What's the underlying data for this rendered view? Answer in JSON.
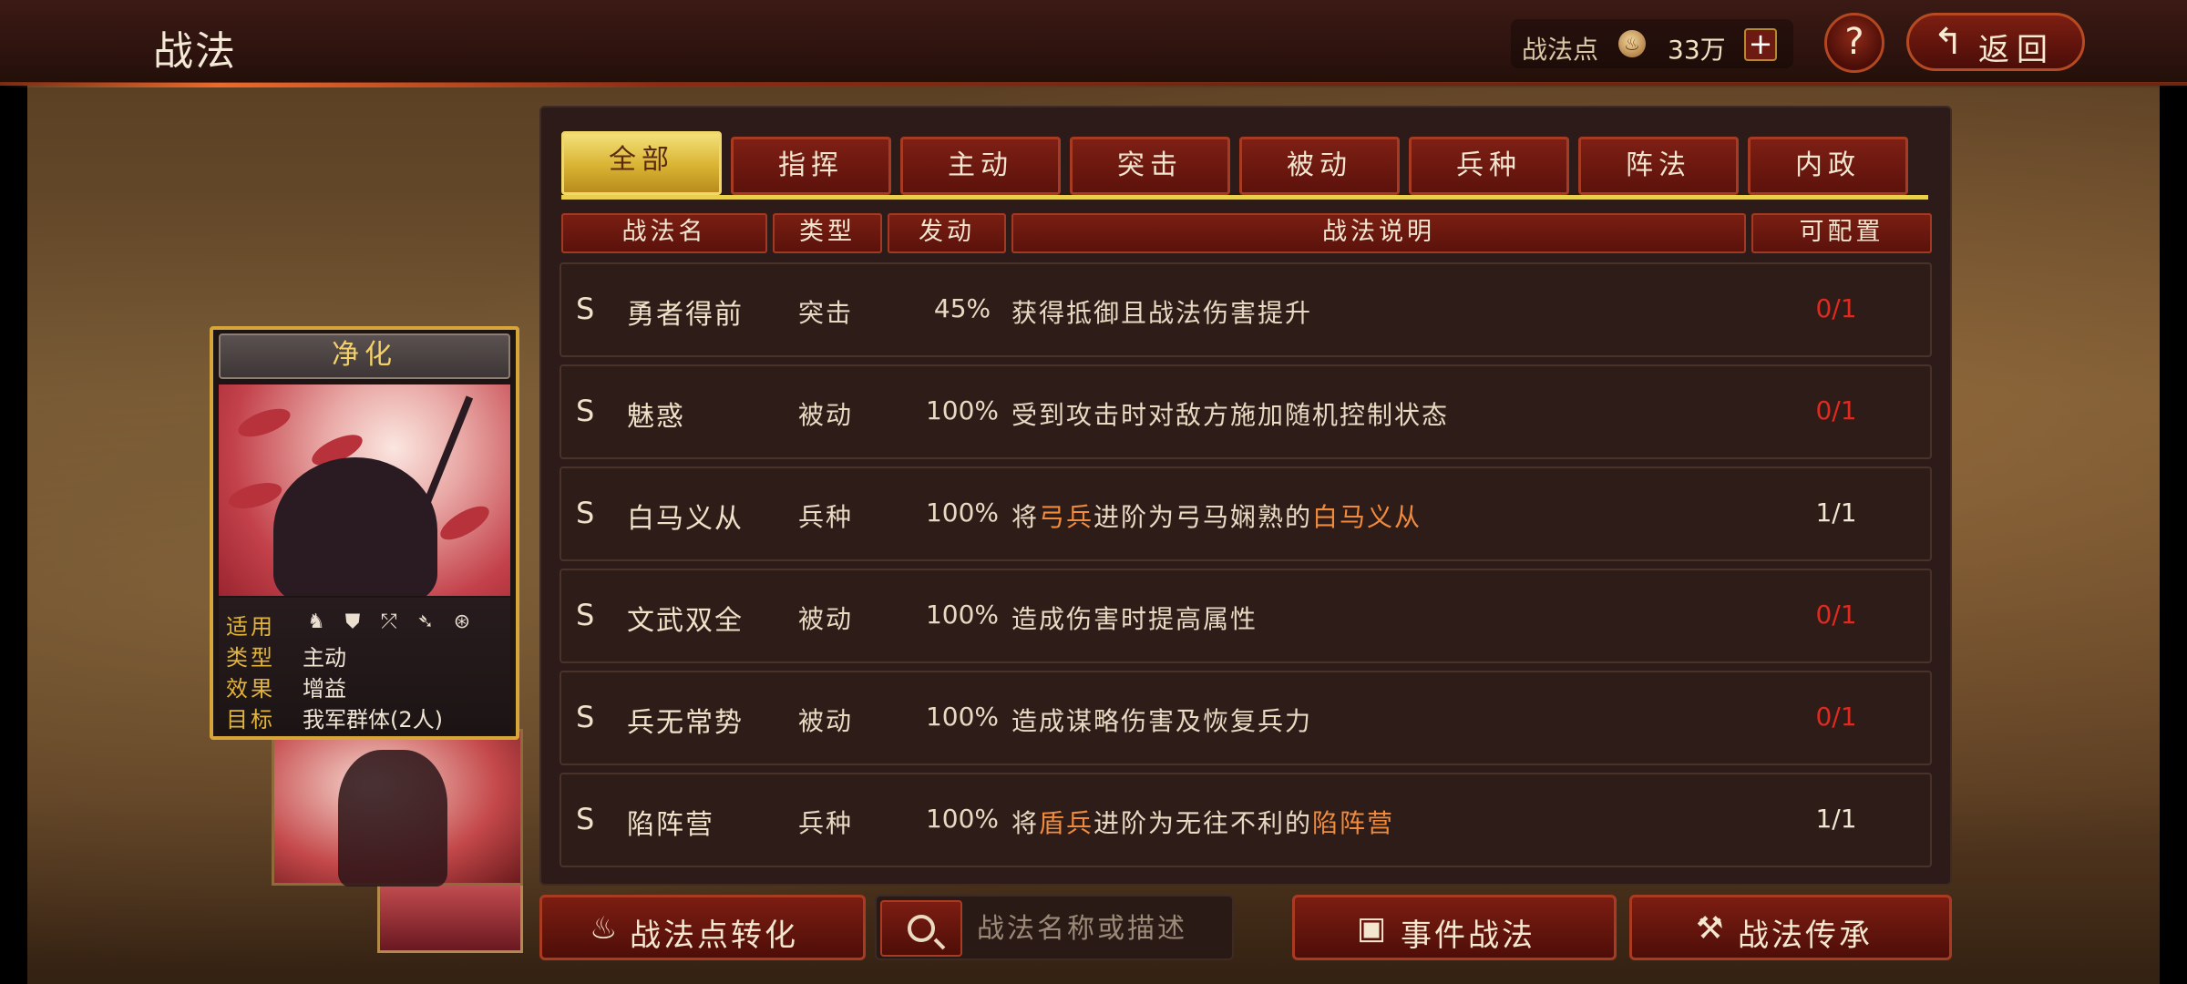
{
  "header": {
    "title": "战法",
    "points_label": "战法点",
    "points_icon": "flame-coin-icon",
    "points_value": "33万",
    "add_button": "+",
    "help_button": "?",
    "back_label": "返回",
    "back_icon": "return-arrow-icon"
  },
  "tabs": [
    {
      "label": "全部",
      "active": true
    },
    {
      "label": "指挥",
      "active": false
    },
    {
      "label": "主动",
      "active": false
    },
    {
      "label": "突击",
      "active": false
    },
    {
      "label": "被动",
      "active": false
    },
    {
      "label": "兵种",
      "active": false
    },
    {
      "label": "阵法",
      "active": false
    },
    {
      "label": "内政",
      "active": false
    }
  ],
  "columns": [
    "战法名",
    "类型",
    "发动",
    "战法说明",
    "可配置"
  ],
  "rows": [
    {
      "grade": "S",
      "name": "勇者得前",
      "type": "突击",
      "rate": "45%",
      "desc": [
        {
          "t": "获得抵御且战法伤害提升",
          "hl": false
        }
      ],
      "count": "0/1",
      "count_color": "red"
    },
    {
      "grade": "S",
      "name": "魅惑",
      "type": "被动",
      "rate": "100%",
      "desc": [
        {
          "t": "受到攻击时对敌方施加随机控制状态",
          "hl": false
        }
      ],
      "count": "0/1",
      "count_color": "red"
    },
    {
      "grade": "S",
      "name": "白马义从",
      "type": "兵种",
      "rate": "100%",
      "desc": [
        {
          "t": "将",
          "hl": false
        },
        {
          "t": "弓兵",
          "hl": true
        },
        {
          "t": "进阶为弓马娴熟的",
          "hl": false
        },
        {
          "t": "白马义从",
          "hl": true
        }
      ],
      "count": "1/1",
      "count_color": "white"
    },
    {
      "grade": "S",
      "name": "文武双全",
      "type": "被动",
      "rate": "100%",
      "desc": [
        {
          "t": "造成伤害时提高属性",
          "hl": false
        }
      ],
      "count": "0/1",
      "count_color": "red"
    },
    {
      "grade": "S",
      "name": "兵无常势",
      "type": "被动",
      "rate": "100%",
      "desc": [
        {
          "t": "造成谋略伤害及恢复兵力",
          "hl": false
        }
      ],
      "count": "0/1",
      "count_color": "red"
    },
    {
      "grade": "S",
      "name": "陷阵营",
      "type": "兵种",
      "rate": "100%",
      "desc": [
        {
          "t": "将",
          "hl": false
        },
        {
          "t": "盾兵",
          "hl": true
        },
        {
          "t": "进阶为无往不利的",
          "hl": false
        },
        {
          "t": "陷阵营",
          "hl": true
        }
      ],
      "count": "1/1",
      "count_color": "white"
    }
  ],
  "card": {
    "title": "净化",
    "labels": {
      "applies": "适用",
      "type": "类型",
      "effect": "效果",
      "target": "目标"
    },
    "type": "主动",
    "effect": "增益",
    "target": "我军群体(2人)",
    "troop_icons": [
      "cavalry-icon",
      "shield-infantry-icon",
      "archer-icon",
      "spear-icon",
      "siege-icon"
    ]
  },
  "bottom": {
    "convert_label": "战法点转化",
    "convert_icon": "flame-coin-icon",
    "search_placeholder": "战法名称或描述",
    "search_icon": "search-icon",
    "event_label": "事件战法",
    "event_icon": "event-scroll-icon",
    "inherit_label": "战法传承",
    "inherit_icon": "hammer-icon"
  },
  "colors": {
    "active_tab": "#d9b332",
    "tab": "#7e1f14",
    "highlight_text": "#f08a3c",
    "red_count": "#e3281e",
    "card_border": "#d7a63a"
  }
}
